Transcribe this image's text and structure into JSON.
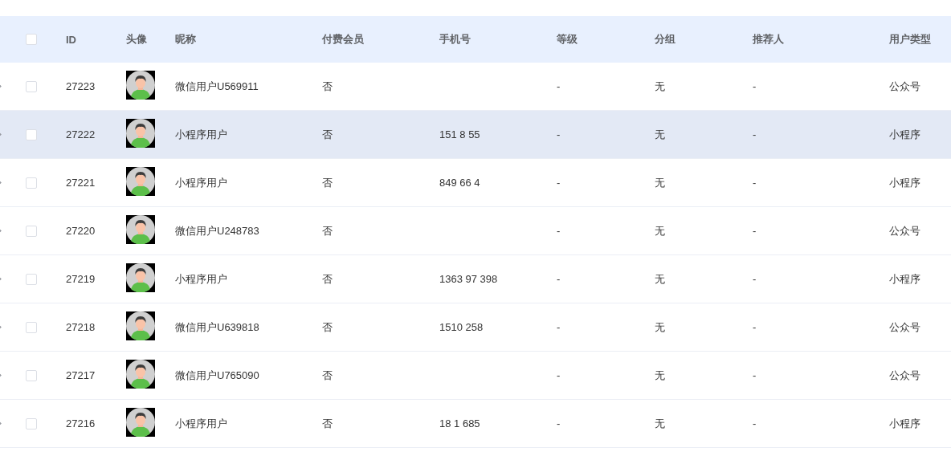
{
  "table": {
    "select_all_checked": false,
    "columns": [
      "ID",
      "头像",
      "昵称",
      "付费会员",
      "手机号",
      "等级",
      "分组",
      "推荐人",
      "用户类型"
    ],
    "rows": [
      {
        "id": "27223",
        "nickname": "微信用户U569911",
        "paid": "否",
        "phone": "",
        "level": "-",
        "group": "无",
        "referrer": "-",
        "user_type": "公众号",
        "highlighted": false
      },
      {
        "id": "27222",
        "nickname": "小程序用户",
        "paid": "否",
        "phone": "151 8 55",
        "level": "-",
        "group": "无",
        "referrer": "-",
        "user_type": "小程序",
        "highlighted": true
      },
      {
        "id": "27221",
        "nickname": "小程序用户",
        "paid": "否",
        "phone": "849 66 4",
        "level": "-",
        "group": "无",
        "referrer": "-",
        "user_type": "小程序",
        "highlighted": false
      },
      {
        "id": "27220",
        "nickname": "微信用户U248783",
        "paid": "否",
        "phone": "",
        "level": "-",
        "group": "无",
        "referrer": "-",
        "user_type": "公众号",
        "highlighted": false
      },
      {
        "id": "27219",
        "nickname": "小程序用户",
        "paid": "否",
        "phone": "1363 97 398",
        "level": "-",
        "group": "无",
        "referrer": "-",
        "user_type": "小程序",
        "highlighted": false
      },
      {
        "id": "27218",
        "nickname": "微信用户U639818",
        "paid": "否",
        "phone": "1510 258",
        "level": "-",
        "group": "无",
        "referrer": "-",
        "user_type": "公众号",
        "highlighted": false
      },
      {
        "id": "27217",
        "nickname": "微信用户U765090",
        "paid": "否",
        "phone": "",
        "level": "-",
        "group": "无",
        "referrer": "-",
        "user_type": "公众号",
        "highlighted": false
      },
      {
        "id": "27216",
        "nickname": "小程序用户",
        "paid": "否",
        "phone": "18 1 685",
        "level": "-",
        "group": "无",
        "referrer": "-",
        "user_type": "小程序",
        "highlighted": false
      }
    ]
  }
}
